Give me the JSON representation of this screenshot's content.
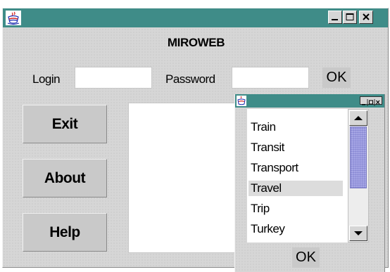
{
  "window": {
    "title": ""
  },
  "header": {
    "title": "MIROWEB"
  },
  "login": {
    "login_label": "Login",
    "login_value": "",
    "password_label": "Password",
    "password_value": "",
    "ok_label": "OK"
  },
  "buttons": {
    "exit": "Exit",
    "about": "About",
    "help": "Help"
  },
  "dialog": {
    "title": "",
    "items": [
      "Train",
      "Transit",
      "Transport",
      "Travel",
      "Trip",
      "Turkey"
    ],
    "selected": "Travel",
    "ok_label": "OK"
  },
  "colors": {
    "titlebar": "#3f8c88",
    "window_bg": "#d6d6d6",
    "scroll_thumb": "#a7a7e6"
  },
  "icons": [
    "java-cup-icon",
    "minimize-icon",
    "maximize-icon",
    "close-icon",
    "scroll-up-arrow-icon",
    "scroll-down-arrow-icon"
  ]
}
